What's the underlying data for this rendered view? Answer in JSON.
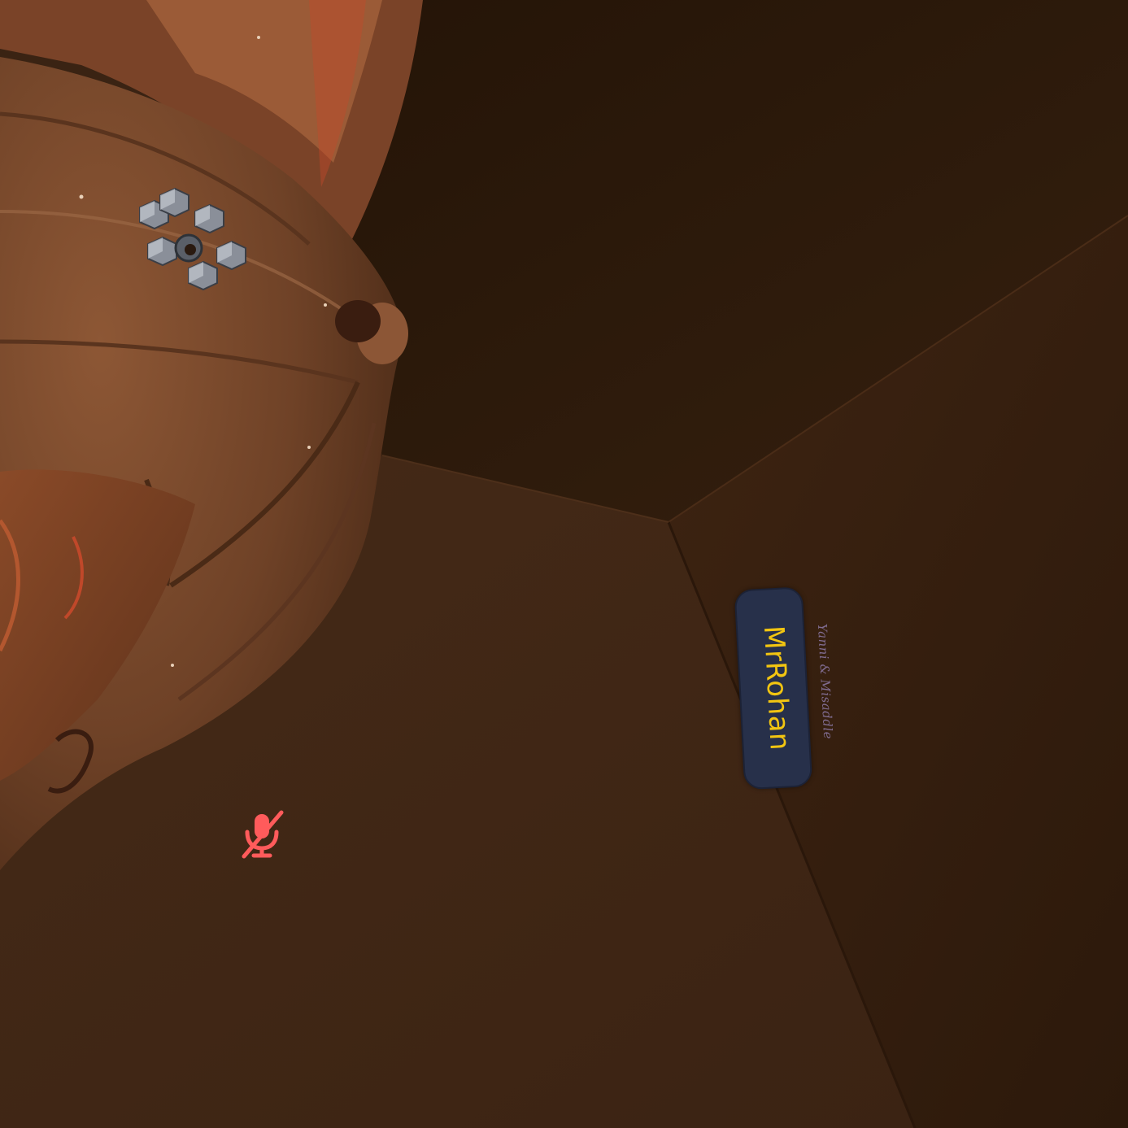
{
  "scene": {
    "type": "vr-world-view",
    "colors": {
      "ceiling": "#2b180c",
      "left_wall": "#3d2514",
      "right_wall": "#3a2112",
      "hair": "#7a4a2e",
      "hair_highlight": "#a36a44",
      "skin": "#7a4023"
    }
  },
  "nameplate": {
    "name": "MrRohan",
    "tag": "Yanni & Misaddle",
    "name_color": "#f2c511",
    "background_color": "#27304a"
  },
  "mic_status": {
    "icon": "mic-muted-icon",
    "color": "#ff5b5b",
    "state": "muted"
  },
  "hair_accessory": {
    "icon": "hex-flower-hairclip"
  }
}
